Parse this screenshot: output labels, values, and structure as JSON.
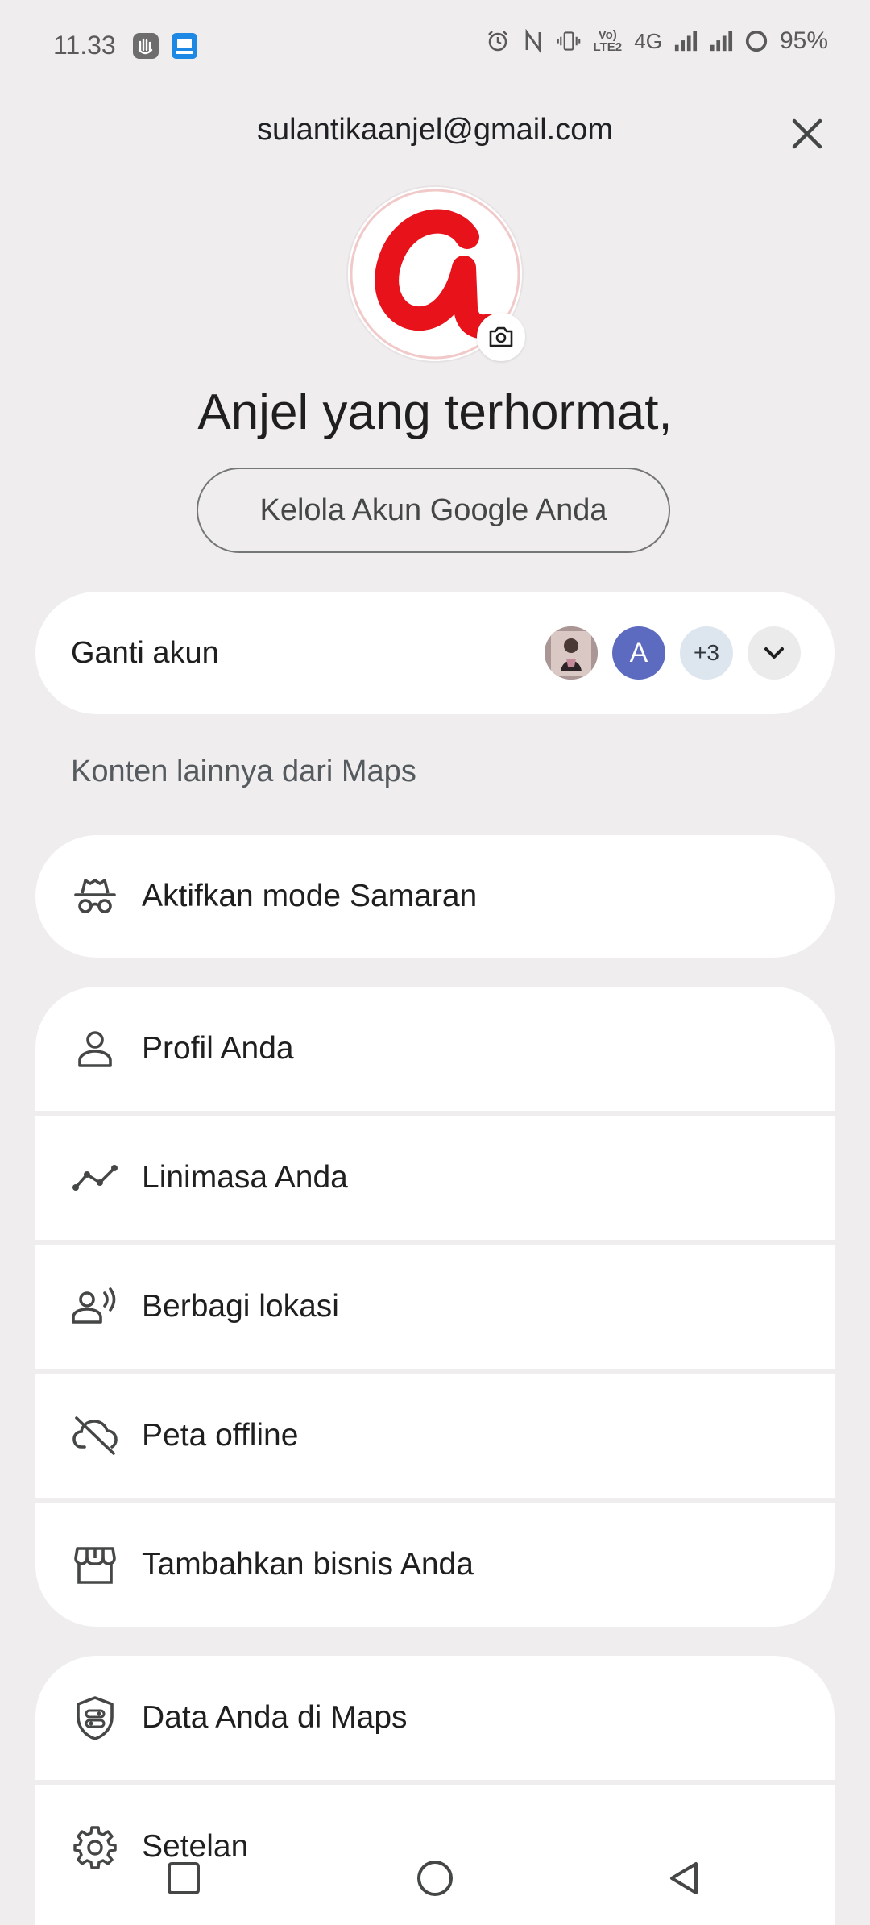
{
  "status_bar": {
    "time": "11.33",
    "network": "4G",
    "volte": "Vo) LTE2",
    "battery": "95%"
  },
  "header": {
    "email": "sulantikaanjel@gmail.com",
    "greeting": "Anjel yang terhormat,",
    "manage_button": "Kelola Akun Google Anda"
  },
  "switch_account": {
    "label": "Ganti akun",
    "accounts": [
      "A",
      "+3"
    ]
  },
  "section_label": "Konten lainnya dari Maps",
  "incognito": {
    "label": "Aktifkan mode Samaran"
  },
  "menu_group_1": [
    {
      "label": "Profil Anda",
      "icon": "person-icon"
    },
    {
      "label": "Linimasa Anda",
      "icon": "timeline-icon"
    },
    {
      "label": "Berbagi lokasi",
      "icon": "location-sharing-icon"
    },
    {
      "label": "Peta offline",
      "icon": "cloud-off-icon"
    },
    {
      "label": "Tambahkan bisnis Anda",
      "icon": "storefront-icon"
    }
  ],
  "menu_group_2": [
    {
      "label": "Data Anda di Maps",
      "icon": "shield-data-icon"
    },
    {
      "label": "Setelan",
      "icon": "gear-icon"
    }
  ],
  "colors": {
    "background": "#efedee",
    "card": "#ffffff",
    "account_avatar": "#5c6bc0",
    "logo_red": "#e8121b"
  }
}
